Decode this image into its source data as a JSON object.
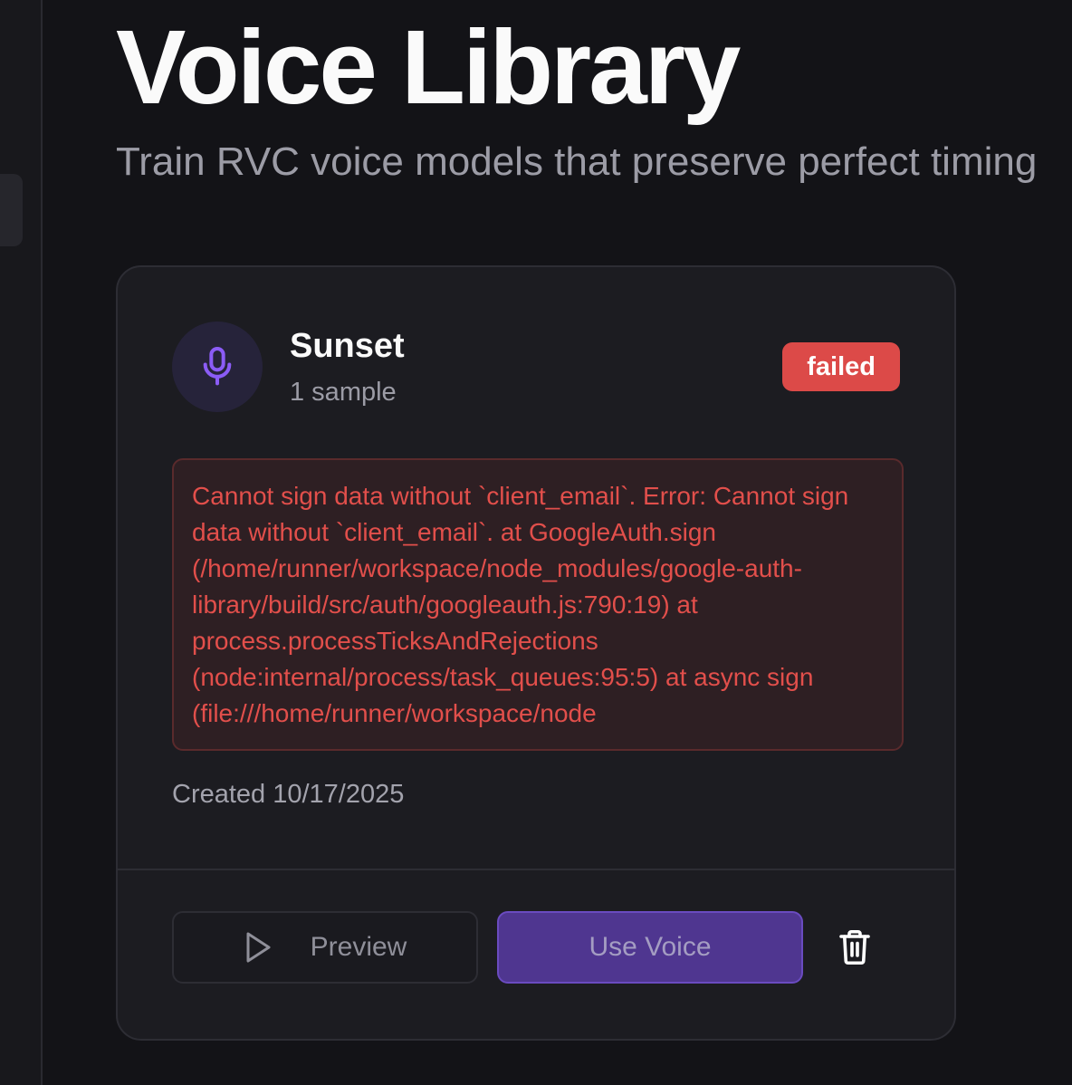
{
  "header": {
    "title": "Voice Library",
    "subtitle": "Train RVC voice models that preserve perfect timing"
  },
  "voice_card": {
    "icon": "microphone-icon",
    "name": "Sunset",
    "samples": "1 sample",
    "status": "failed",
    "error": "Cannot sign data without `client_email`. Error: Cannot sign data without `client_email`. at GoogleAuth.sign (/home/runner/workspace/node_modules/google-auth-library/build/src/auth/googleauth.js:790:19) at process.processTicksAndRejections (node:internal/process/task_queues:95:5) at async sign (file:///home/runner/workspace/node",
    "created": "Created 10/17/2025",
    "preview_label": "Preview",
    "use_label": "Use Voice"
  },
  "colors": {
    "background": "#131317",
    "card": "#1c1c21",
    "accent": "#4f3690",
    "danger": "#dc4a48"
  }
}
